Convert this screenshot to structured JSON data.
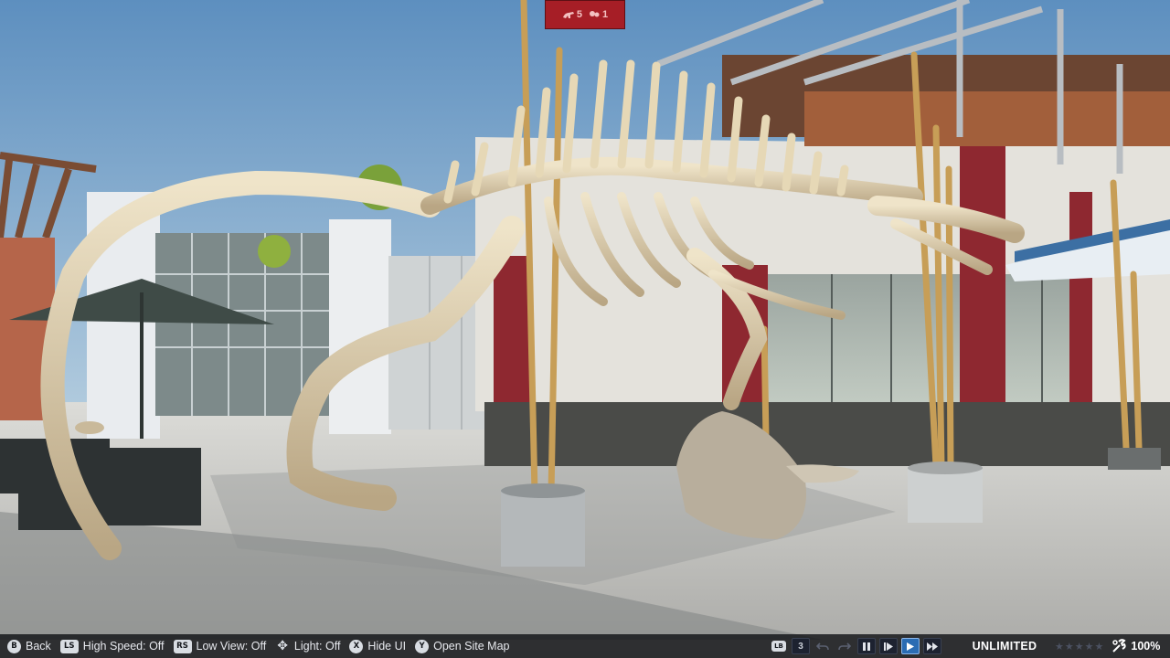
{
  "top_indicator": {
    "left_value": "5",
    "right_value": "1",
    "color": "#a61e26"
  },
  "hints": [
    {
      "glyph": "B",
      "label": "Back"
    },
    {
      "glyph": "LS",
      "label": "High Speed: Off"
    },
    {
      "glyph": "RS",
      "label": "Low View: Off"
    },
    {
      "glyph": "✥",
      "label": "Light: Off"
    },
    {
      "glyph": "X",
      "label": "Hide UI"
    },
    {
      "glyph": "Y",
      "label": "Open Site Map"
    }
  ],
  "controls": {
    "lb_glyph": "LB",
    "speed_level": "3",
    "undo_icon": "undo-icon",
    "redo_icon": "redo-icon",
    "pause_icon": "pause-icon",
    "play_icon": "play-icon",
    "fast_icon": "fast-forward-icon",
    "budget": "UNLIMITED",
    "rating_stars": 5,
    "rating_filled": 0,
    "approval_icon": "wrench-settings-icon",
    "approval": "100%"
  },
  "colors": {
    "accent_active": "#2b6cb3",
    "bar_bg": "#0a0c10"
  }
}
